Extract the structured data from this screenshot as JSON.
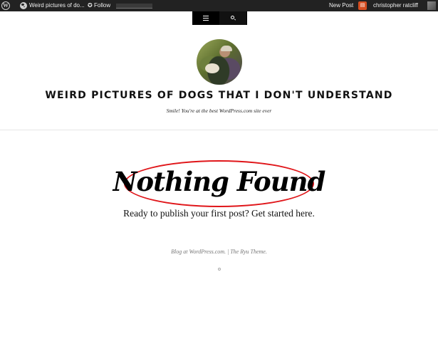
{
  "adminbar": {
    "site_title": "Weird pictures of do...",
    "follow_label": "Follow",
    "new_post_label": "New Post",
    "user_name": "christopher ratcliff"
  },
  "header": {
    "site_title": "WEIRD PICTURES OF DOGS THAT I DON'T UNDERSTAND",
    "tagline": "Smile! You're at the best WordPress.com site ever"
  },
  "main": {
    "page_title": "Nothing Found",
    "prompt_text": "Ready to publish your first post? Get started here."
  },
  "footer": {
    "blog_link": "Blog at WordPress.com.",
    "separator": " | ",
    "theme_link": "The Ryu Theme."
  },
  "colors": {
    "adminbar_bg": "#222222",
    "annotation_oval": "#e0161a",
    "notification": "#d54e21"
  }
}
